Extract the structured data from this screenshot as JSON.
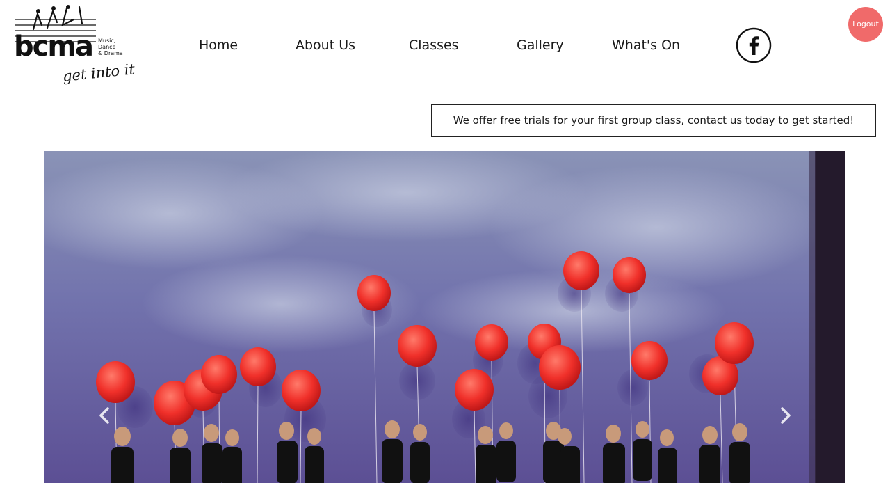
{
  "logo": {
    "text": "bcma",
    "tagline_lines": [
      "Music,",
      "Dance",
      "& Drama"
    ],
    "slogan": "get into it!"
  },
  "nav": {
    "items": [
      {
        "label": "Home"
      },
      {
        "label": "About Us"
      },
      {
        "label": "Classes"
      },
      {
        "label": "Gallery"
      },
      {
        "label": "What's On"
      }
    ],
    "social_icon": "facebook-icon"
  },
  "logout": {
    "label": "Logout"
  },
  "promo": {
    "text": "We offer free trials for your first group class, contact us today to get started!"
  },
  "carousel": {
    "prev_icon": "chevron-left-icon",
    "next_icon": "chevron-right-icon"
  },
  "colors": {
    "logout_bg": "#f06a6a",
    "balloon_red": "#f0302a",
    "sky": "#6e6fa8",
    "text": "#1a1a1a"
  }
}
